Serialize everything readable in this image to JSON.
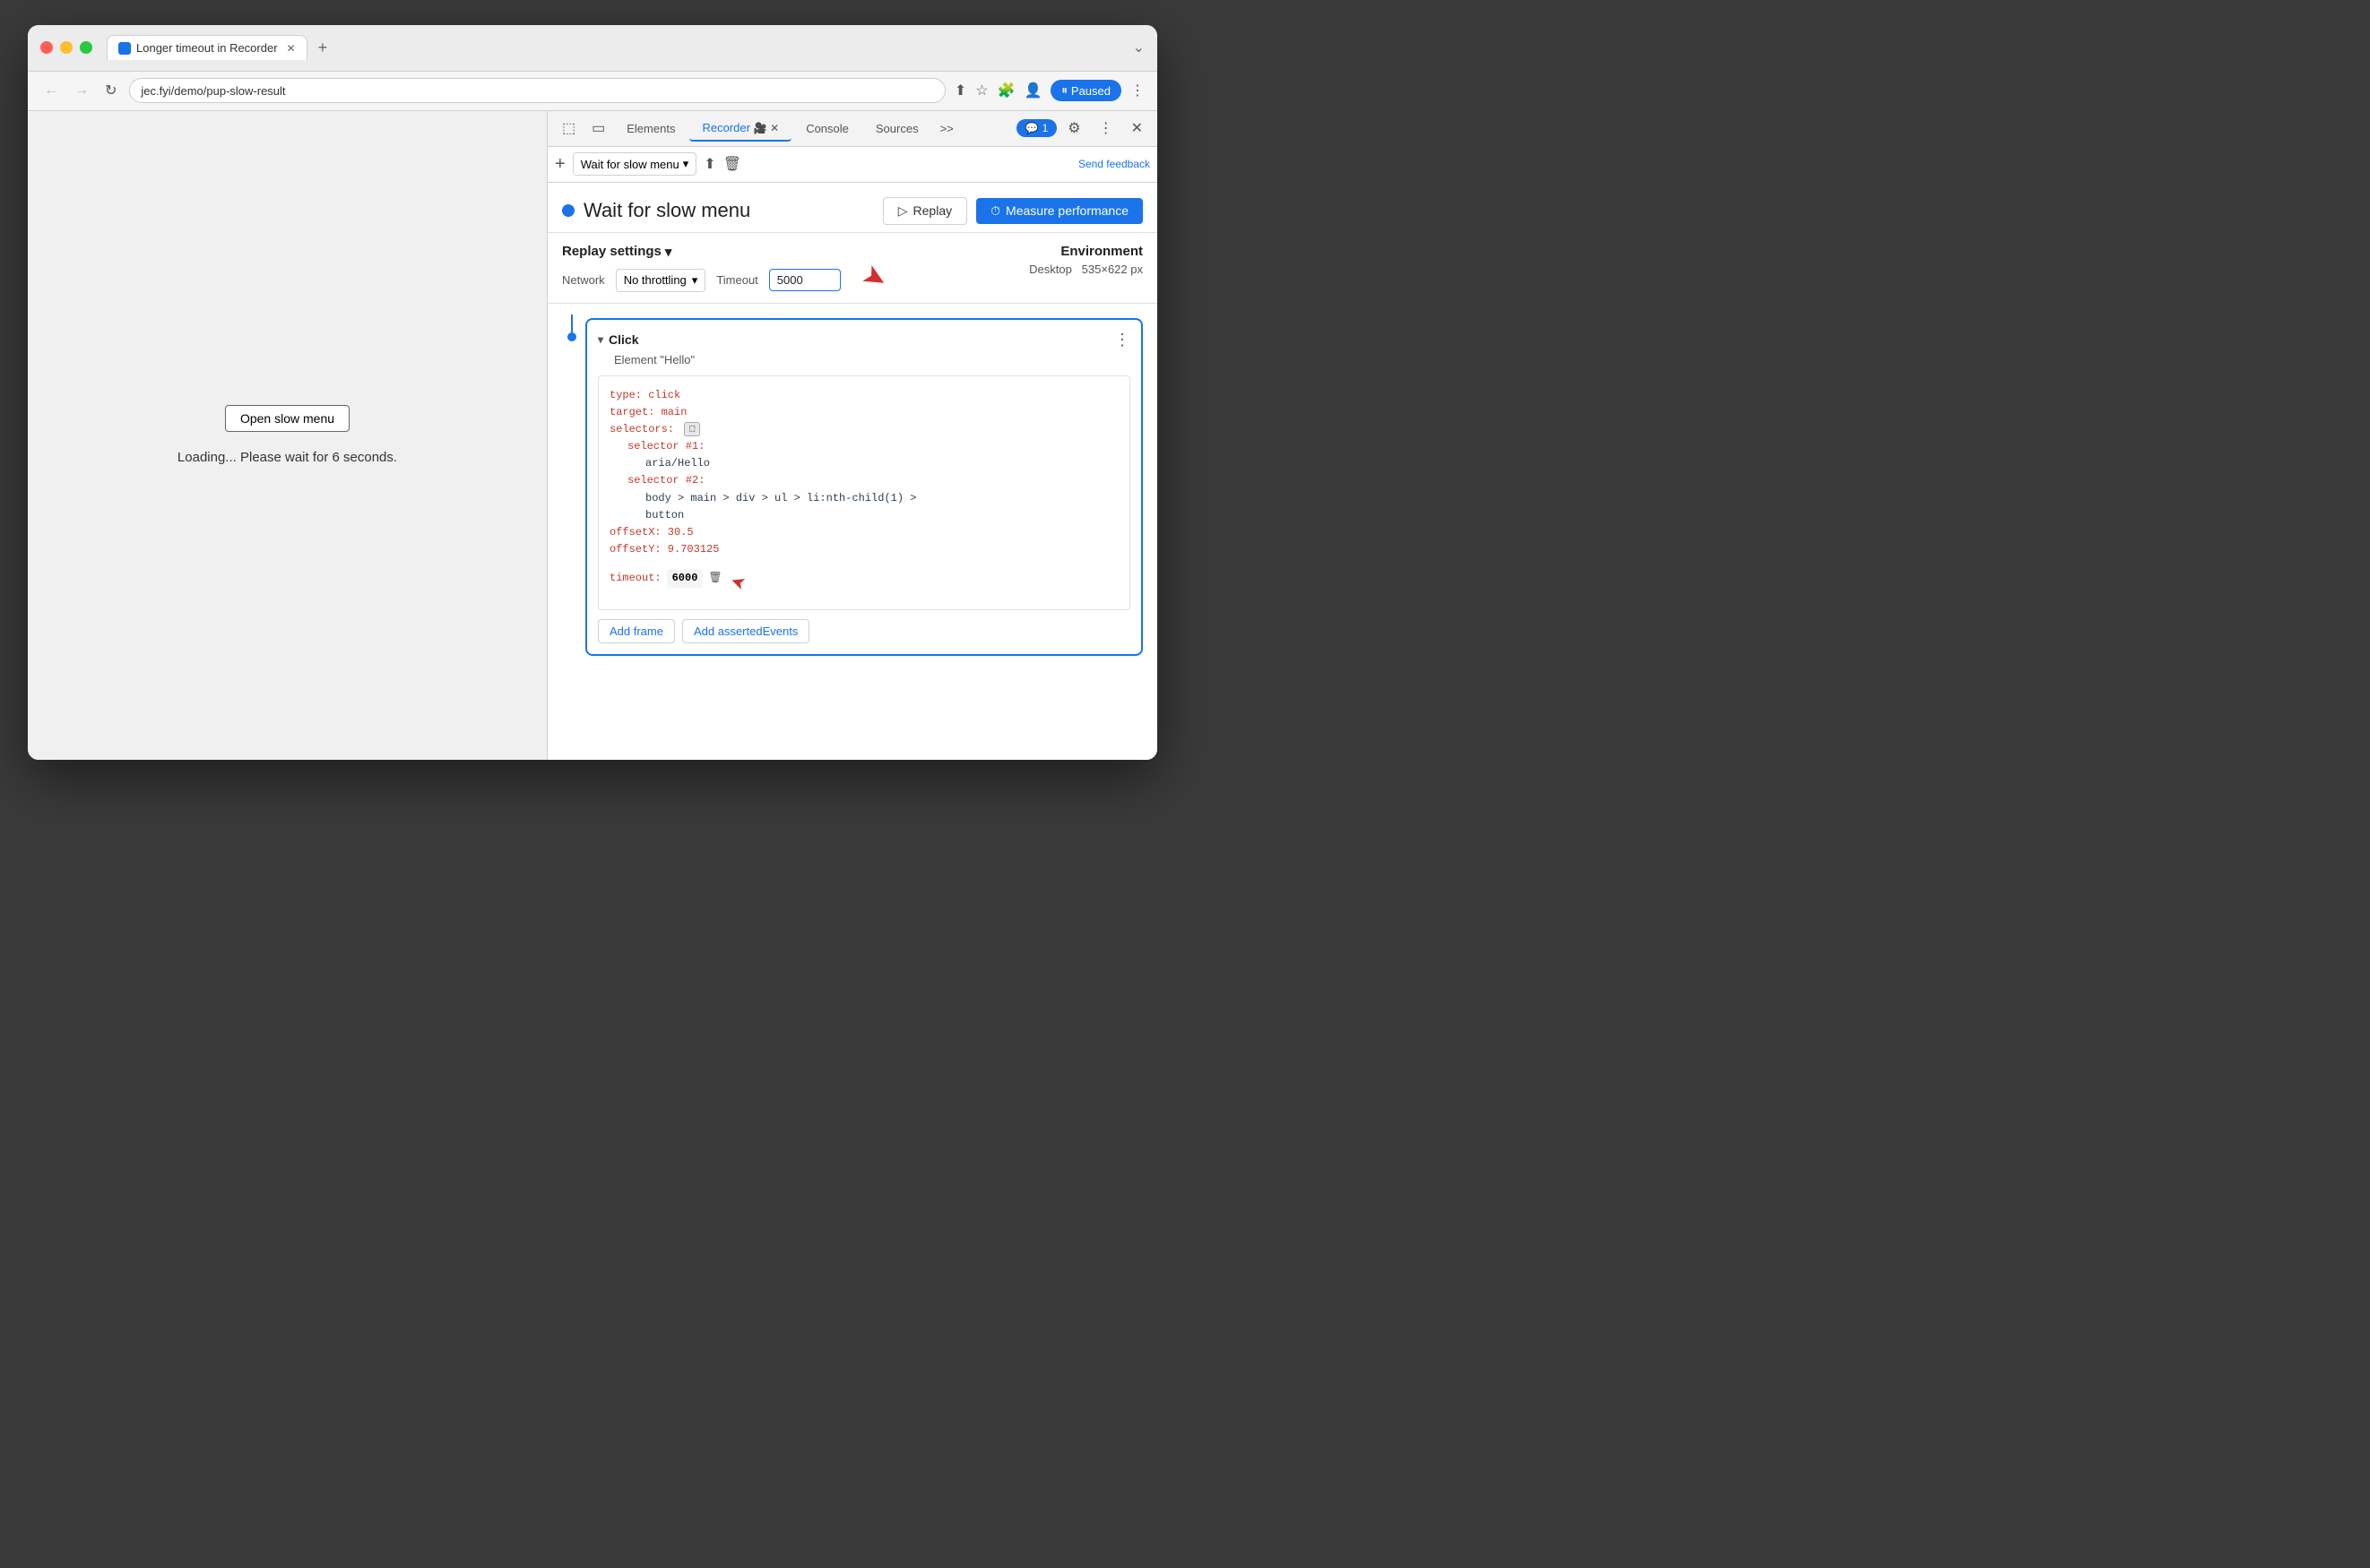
{
  "window": {
    "title": "Longer timeout in Recorder"
  },
  "browser": {
    "url": "jec.fyi/demo/pup-slow-result",
    "paused_label": "Paused"
  },
  "page_content": {
    "open_menu_btn": "Open slow menu",
    "loading_text": "Loading... Please wait for 6 seconds."
  },
  "devtools": {
    "tabs": [
      {
        "label": "Elements",
        "active": false
      },
      {
        "label": "Recorder",
        "active": true
      },
      {
        "label": "Console",
        "active": false
      },
      {
        "label": "Sources",
        "active": false
      }
    ],
    "chat_badge": "1"
  },
  "recorder": {
    "recording_name": "Wait for slow menu",
    "send_feedback": "Send feedback",
    "replay_btn": "Replay",
    "measure_btn": "Measure performance",
    "replay_settings": {
      "title": "Replay settings",
      "network_label": "Network",
      "network_value": "No throttling",
      "timeout_label": "Timeout",
      "timeout_value": "5000"
    },
    "environment": {
      "title": "Environment",
      "type": "Desktop",
      "dimensions": "535×622 px"
    },
    "click_step": {
      "title": "Click",
      "subtitle": "Element \"Hello\"",
      "type_line": "type: click",
      "target_line": "target: main",
      "selectors_line": "selectors:",
      "selector1_label": "selector #1:",
      "selector1_value": "aria/Hello",
      "selector2_label": "selector #2:",
      "selector2_value": "body > main > div > ul > li:nth-child(1) >",
      "selector2_value2": "button",
      "offsetX_line": "offsetX: 30.5",
      "offsetY_line": "offsetY: 9.703125",
      "timeout_label": "timeout:",
      "timeout_value": "6000",
      "add_frame_btn": "Add frame",
      "add_asserted_btn": "Add assertedEvents"
    }
  }
}
